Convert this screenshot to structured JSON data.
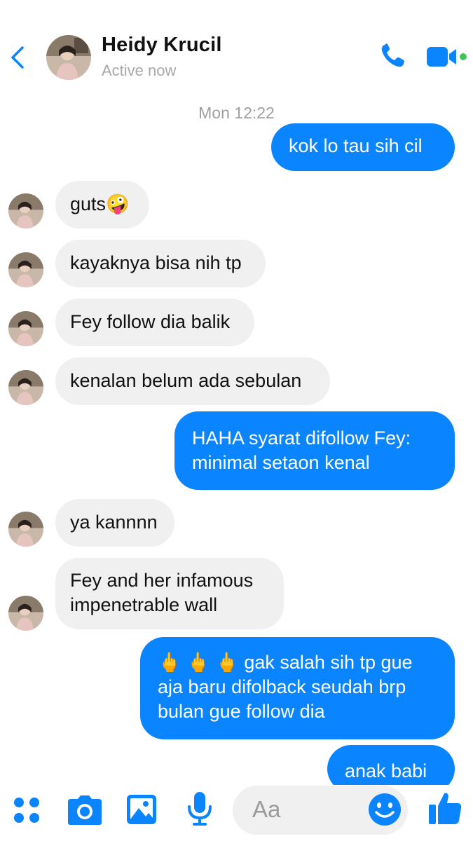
{
  "header": {
    "contact_name": "Heidy Krucil",
    "status": "Active now",
    "online_color": "#3fc45a"
  },
  "conversation": {
    "timestamp": "Mon 12:22",
    "messages": [
      {
        "from": "me",
        "lines": [
          "kok lo tau sih cil"
        ]
      },
      {
        "from": "them",
        "lines": [
          "guts🤪"
        ]
      },
      {
        "from": "them",
        "lines": [
          "kayaknya bisa nih tp"
        ]
      },
      {
        "from": "them",
        "lines": [
          "Fey follow dia balik"
        ]
      },
      {
        "from": "them",
        "lines": [
          "kenalan belum ada sebulan"
        ]
      },
      {
        "from": "me",
        "lines": [
          "HAHA syarat difollow Fey:",
          "minimal setaon kenal"
        ]
      },
      {
        "from": "them",
        "lines": [
          "ya kannnn"
        ]
      },
      {
        "from": "them",
        "lines": [
          "Fey and her infamous",
          "impenetrable wall"
        ]
      },
      {
        "from": "me",
        "lines": [
          "🖕 🖕 🖕  gak salah sih tp gue",
          "aja baru difolback seudah brp",
          "bulan gue follow dia"
        ]
      },
      {
        "from": "me",
        "lines": [
          "anak babi"
        ]
      }
    ]
  },
  "composer": {
    "placeholder": "Aa",
    "tools": [
      "grid-menu-icon",
      "camera-icon",
      "photo-icon",
      "microphone-icon",
      "emoji-icon",
      "thumbs-up-icon"
    ]
  },
  "colors": {
    "accent": "#0a84ff",
    "incoming_bubble": "#f0f0f0",
    "muted_text": "#a0a0a0"
  }
}
